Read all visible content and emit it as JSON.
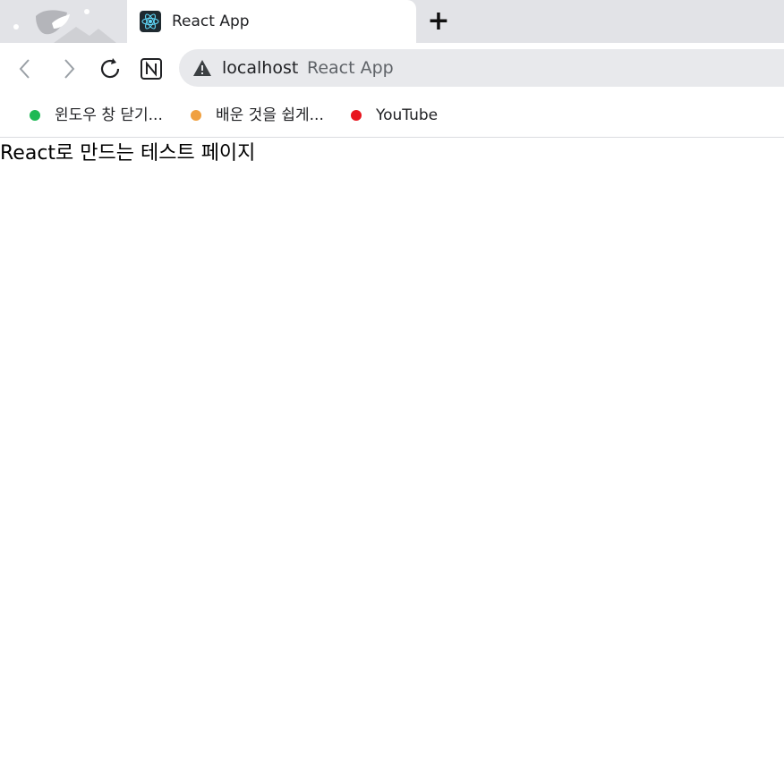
{
  "tab": {
    "title": "React App",
    "favicon": "react-icon",
    "new_tab_label": "+"
  },
  "toolbar": {
    "back": "chevron-left-icon",
    "forward": "chevron-right-icon",
    "reload": "reload-icon",
    "extension": "n-logo-icon"
  },
  "omnibox": {
    "security_icon": "warning-icon",
    "host": "localhost",
    "page_title": "React App"
  },
  "bookmarks": [
    {
      "label": "윈도우 창 닫기...",
      "color": "#1db954"
    },
    {
      "label": "배운 것을 쉽게...",
      "color": "#f0a040"
    },
    {
      "label": "YouTube",
      "color": "#e8141d"
    }
  ],
  "page": {
    "text": "React로 만드는 테스트 페이지"
  }
}
